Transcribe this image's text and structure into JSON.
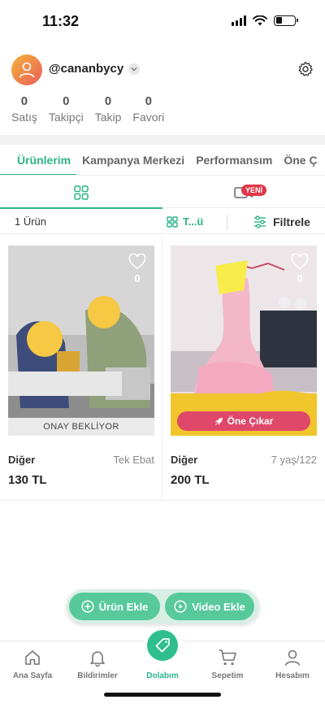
{
  "status_bar": {
    "time": "11:32"
  },
  "profile": {
    "username": "@cananbycy",
    "stats": [
      {
        "value": "0",
        "label": "Satış"
      },
      {
        "value": "0",
        "label": "Takipçi"
      },
      {
        "value": "0",
        "label": "Takip"
      },
      {
        "value": "0",
        "label": "Favori"
      }
    ]
  },
  "tabs": [
    "Ürünlerim",
    "Kampanya Merkezi",
    "Performansım",
    "Öne Ç"
  ],
  "view_switch": {
    "new_badge": "YENİ"
  },
  "filter_bar": {
    "count": "1 Ürün",
    "sort_label": "T...ü",
    "filter_label": "Filtrele"
  },
  "products": [
    {
      "favorites": "0",
      "status": "ONAY BEKLİYOR",
      "category": "Diğer",
      "size": "Tek Ebat",
      "price": "130 TL"
    },
    {
      "favorites": "0",
      "promote": "Öne Çıkar",
      "category": "Diğer",
      "size": "7 yaş/122",
      "price": "200 TL"
    }
  ],
  "actions": {
    "add_product": "Ürün Ekle",
    "add_video": "Video Ekle"
  },
  "bottom_nav": [
    {
      "label": "Ana Sayfa",
      "icon": "home-icon"
    },
    {
      "label": "Bildirimler",
      "icon": "bell-icon"
    },
    {
      "label": "Dolabım",
      "icon": "hanger-tag-icon"
    },
    {
      "label": "Sepetim",
      "icon": "cart-icon"
    },
    {
      "label": "Hesabım",
      "icon": "user-icon"
    }
  ],
  "colors": {
    "accent": "#2db48a",
    "promote": "#e0486a",
    "badge": "#e0384a"
  }
}
